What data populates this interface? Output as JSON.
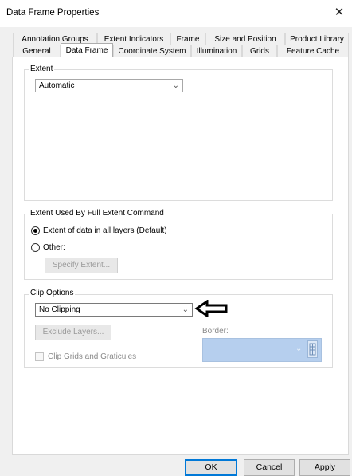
{
  "window": {
    "title": "Data Frame Properties",
    "close_glyph": "✕"
  },
  "tabs_row1": [
    "Annotation Groups",
    "Extent Indicators",
    "Frame",
    "Size and Position",
    "Product Library"
  ],
  "tabs_row2": [
    "General",
    "Data Frame",
    "Coordinate System",
    "Illumination",
    "Grids",
    "Feature Cache"
  ],
  "active_tab": "Data Frame",
  "extent": {
    "legend": "Extent",
    "value": "Automatic"
  },
  "full_extent": {
    "legend": "Extent Used By Full Extent Command",
    "option_default": "Extent of data in all layers (Default)",
    "option_other": "Other:",
    "specify_button": "Specify Extent...",
    "selected": "default"
  },
  "clip": {
    "legend": "Clip Options",
    "value": "No Clipping",
    "exclude_button": "Exclude Layers...",
    "border_label": "Border:",
    "grids_checkbox": "Clip Grids and Graticules"
  },
  "footer": {
    "ok": "OK",
    "cancel": "Cancel",
    "apply": "Apply"
  },
  "colors": {
    "accent": "#0078d7",
    "border_preview": "#b6cfee"
  }
}
